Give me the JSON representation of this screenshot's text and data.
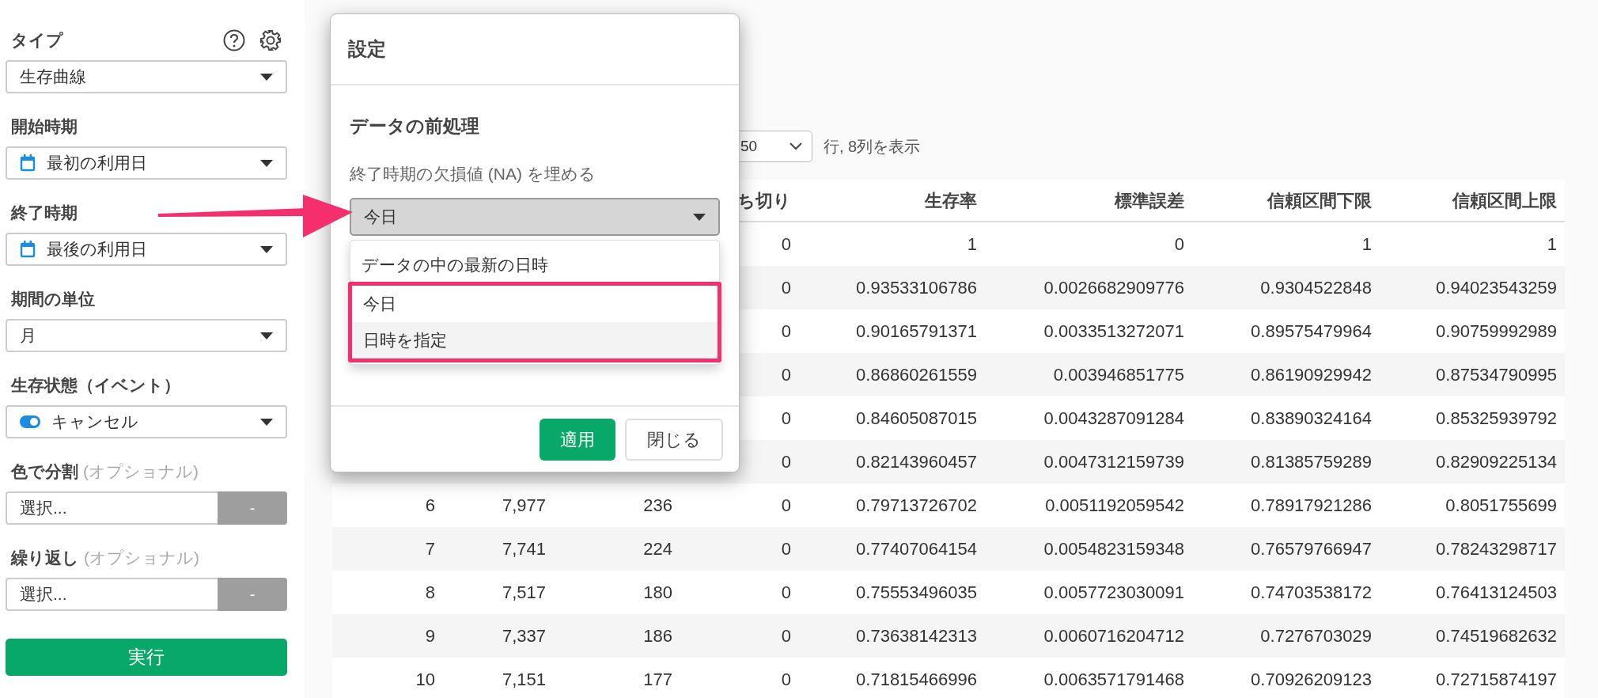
{
  "sidebar": {
    "fields": [
      {
        "kind": "select",
        "label": "タイプ",
        "value": "生存曲線"
      },
      {
        "kind": "date_select",
        "label": "開始時期",
        "value": "最初の利用日"
      },
      {
        "kind": "date_select",
        "label": "終了時期",
        "value": "最後の利用日"
      },
      {
        "kind": "select",
        "label": "期間の単位",
        "value": "月"
      },
      {
        "kind": "toggle_select",
        "label": "生存状態（イベント）",
        "value": "キャンセル",
        "on": true
      },
      {
        "kind": "column_picker",
        "label": "色で分割",
        "note": "(オプショナル)",
        "value": "選択...",
        "button": "-"
      },
      {
        "kind": "column_picker",
        "label": "繰り返し",
        "note": "(オプショナル)",
        "value": "選択...",
        "button": "-"
      }
    ],
    "run_button": "実行"
  },
  "table": {
    "page_size": "50",
    "rows_info": "行, 8列を表示",
    "columns": [
      "ち切り",
      "生存率",
      "標準誤差",
      "信頼区間下限",
      "信頼区間上限"
    ],
    "rows": [
      {
        "cells": [
          "0",
          "1",
          "0",
          "1",
          "1"
        ]
      },
      {
        "cells": [
          "0",
          "0.93533106786",
          "0.0026682909776",
          "0.9304522848",
          "0.94023543259"
        ]
      },
      {
        "cells": [
          "0",
          "0.90165791371",
          "0.0033513272071",
          "0.89575479964",
          "0.90759992989"
        ]
      },
      {
        "cells": [
          "0",
          "0.86860261559",
          "0.003946851775",
          "0.86190929942",
          "0.87534790995"
        ]
      },
      {
        "cells": [
          "0",
          "0.84605087015",
          "0.0043287091284",
          "0.83890324164",
          "0.85325939792"
        ]
      },
      {
        "cells": [
          "0",
          "0.82143960457",
          "0.0047312159739",
          "0.81385759289",
          "0.82909225134"
        ]
      },
      {
        "cells": [
          "6",
          "7,977",
          "236",
          "0",
          "0.79713726702",
          "0.0051192059542",
          "0.78917921286",
          "0.8051755699"
        ]
      },
      {
        "cells": [
          "7",
          "7,741",
          "224",
          "0",
          "0.77407064154",
          "0.0054823159348",
          "0.76579766947",
          "0.78243298717"
        ]
      },
      {
        "cells": [
          "8",
          "7,517",
          "180",
          "0",
          "0.75553496035",
          "0.0057723030091",
          "0.74703538172",
          "0.76413124503"
        ]
      },
      {
        "cells": [
          "9",
          "7,337",
          "186",
          "0",
          "0.73638142313",
          "0.0060716204712",
          "0.7276703029",
          "0.74519682632"
        ]
      },
      {
        "cells": [
          "10",
          "7,151",
          "177",
          "0",
          "0.71815466996",
          "0.0063571791468",
          "0.70926209123",
          "0.72715874197"
        ]
      }
    ]
  },
  "dialog": {
    "title": "設定",
    "section_title": "データの前処理",
    "field_label": "終了時期の欠損値 (NA) を埋める",
    "value": "今日",
    "options": [
      {
        "label": "データの中の最新の日時",
        "highlighted": false
      },
      {
        "label": "今日",
        "highlighted": false
      },
      {
        "label": "日時を指定",
        "highlighted": true
      }
    ],
    "buttons": [
      {
        "kind": "primary",
        "label": "適用"
      },
      {
        "kind": "secondary",
        "label": "閉じる"
      }
    ]
  }
}
